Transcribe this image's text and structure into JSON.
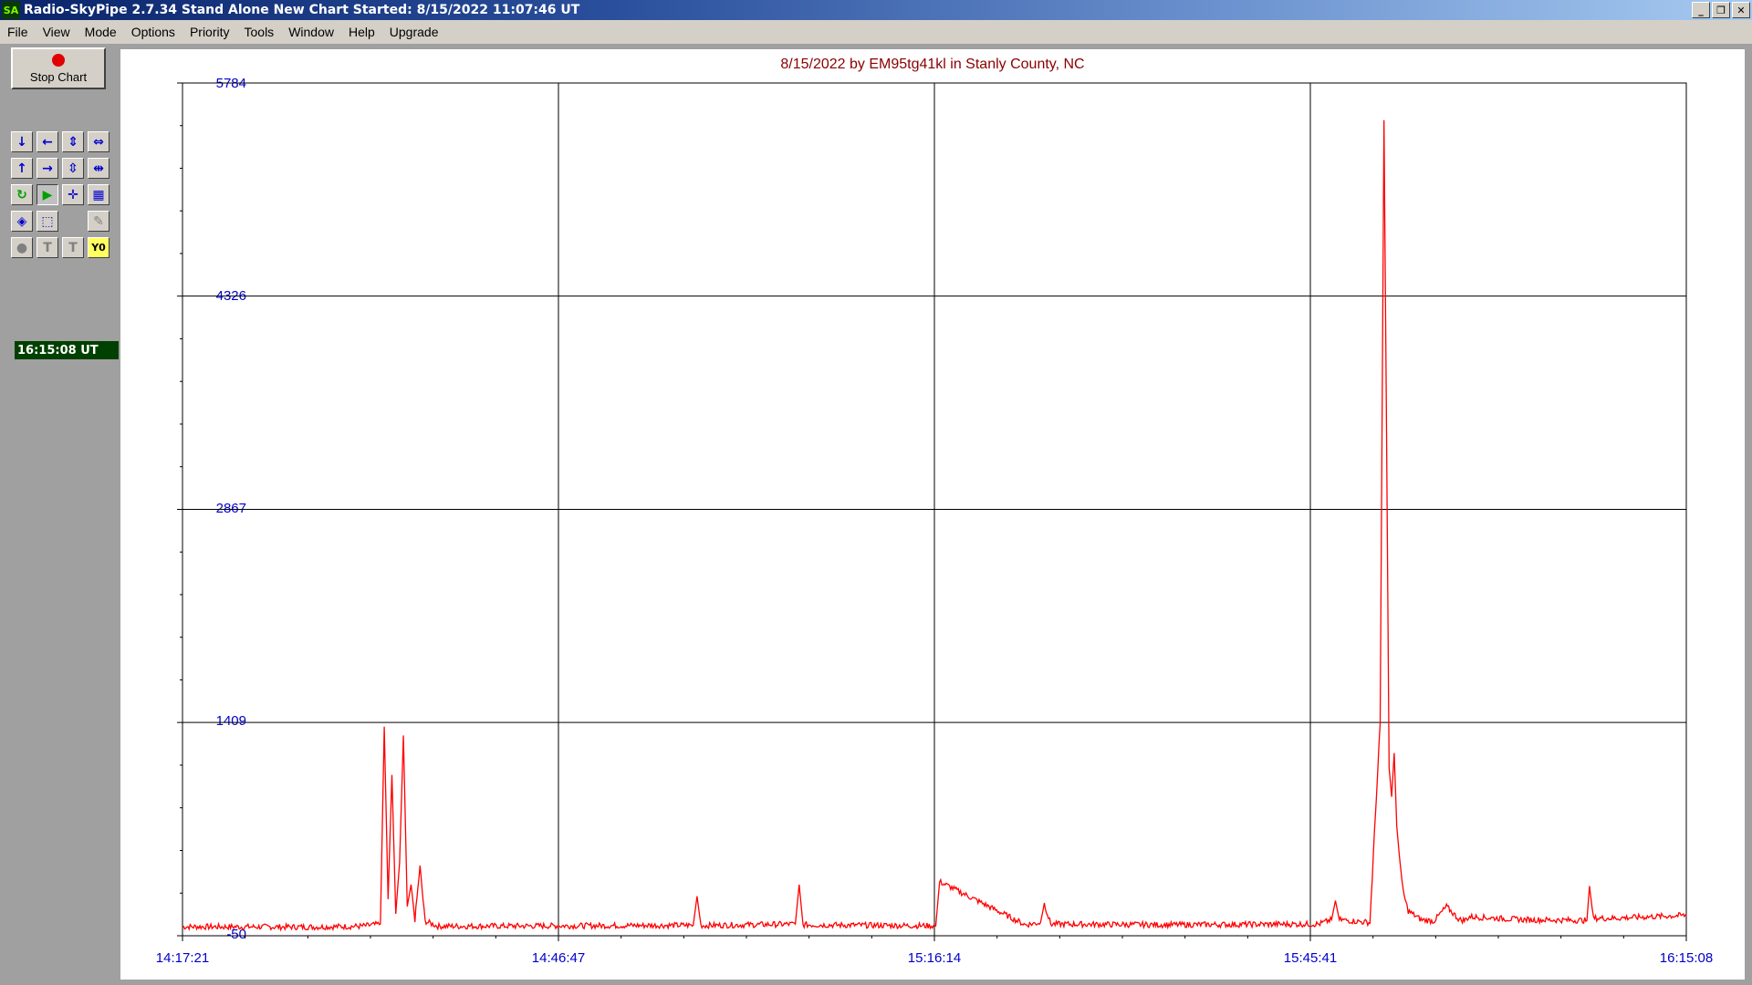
{
  "window": {
    "logo_text": "SA",
    "title": "Radio-SkyPipe  2.7.34  Stand Alone  New Chart Started: 8/15/2022 11:07:46 UT",
    "controls": [
      "_",
      "❐",
      "✕"
    ]
  },
  "menu": [
    "File",
    "View",
    "Mode",
    "Options",
    "Priority",
    "Tools",
    "Window",
    "Help",
    "Upgrade"
  ],
  "toolbar": {
    "stop_chart_label": "Stop Chart",
    "clock": "16:15:08 UT",
    "y0_label": "Y0"
  },
  "colors": {
    "trace": "#ff0000",
    "axis_labels": "#0000cc",
    "title": "#8b0000",
    "grid": "#000000"
  },
  "chart_data": {
    "type": "line",
    "title": "8/15/2022  by  EM95tg41kl  in  Stanly County, NC",
    "y_ticks": [
      "5784",
      "4326",
      "2867",
      "1409",
      "-50"
    ],
    "x_ticks": [
      "14:17:21",
      "14:46:47",
      "15:16:14",
      "15:45:41",
      "16:15:08"
    ],
    "ylim": [
      -50,
      5784
    ],
    "xlim": [
      "14:17:21",
      "16:15:08"
    ],
    "grid": true,
    "series": [
      {
        "color": "#ff0000",
        "x_minutes_since_14_17_21": [
          0,
          10,
          14,
          15.5,
          15.8,
          16.1,
          16.4,
          16.7,
          17.0,
          17.3,
          17.6,
          17.9,
          18.2,
          18.6,
          19.0,
          20,
          30,
          40,
          40.3,
          40.6,
          48,
          48.3,
          48.6,
          59,
          59.3,
          66,
          67.2,
          67.5,
          68,
          77,
          89,
          90,
          90.3,
          90.6,
          93,
          93.8,
          94.1,
          94.3,
          94.5,
          94.7,
          94.9,
          95.1,
          95.3,
          95.6,
          96,
          97,
          98,
          99,
          100,
          100.4,
          100.8,
          105,
          110,
          110.2,
          110.5,
          112,
          117.8
        ],
        "y": [
          12,
          10,
          15,
          30,
          1380,
          200,
          1050,
          100,
          450,
          1320,
          150,
          300,
          60,
          420,
          50,
          15,
          18,
          22,
          220,
          20,
          30,
          300,
          25,
          18,
          320,
          25,
          40,
          170,
          30,
          25,
          30,
          60,
          190,
          60,
          40,
          1400,
          5530,
          3400,
          1100,
          900,
          1200,
          700,
          500,
          250,
          120,
          60,
          50,
          150,
          60,
          55,
          80,
          60,
          55,
          290,
          70,
          70,
          90
        ]
      }
    ]
  }
}
